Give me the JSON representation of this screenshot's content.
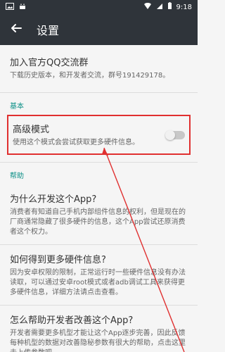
{
  "status": {
    "time": "9:18"
  },
  "appbar": {
    "title": "设置"
  },
  "items": {
    "join_group_title": "加入官方QQ交流群",
    "join_group_desc": "下载历史版本，和开发者交流，群号191429178。",
    "basic_label": "基本",
    "advanced_title": "高级模式",
    "advanced_desc": "使用这个模式会尝试获取更多硬件信息。",
    "help_label": "帮助",
    "why_title": "为什么开发这个App?",
    "why_desc": "消费者有知道自己手机内部组件信息的权利，但是现在的厂商通常隐藏了很多硬件的信息，这个App尝试还原消费者这个权力。",
    "how_title": "如何得到更多硬件信息?",
    "how_desc": "因为安卓权限的限制，正常运行时一些硬件信息没有办法读取，可以通过安卓root模式或者adb调试工具来获得更多硬件信息，详细方法请点击查看。",
    "help_dev_title": "怎么帮助开发者改善这个App?",
    "help_dev_desc": "开发者需要更多机型才能让这个App逐步完善，因此反馈每种机型的数据对改善隐秘参数有很大的帮助，点击这里去上传参数吧。"
  },
  "switches": {
    "advanced_mode": false
  },
  "colors": {
    "appbar": "#2f343a",
    "section": "#0a8f86",
    "highlight": "#e03030"
  }
}
